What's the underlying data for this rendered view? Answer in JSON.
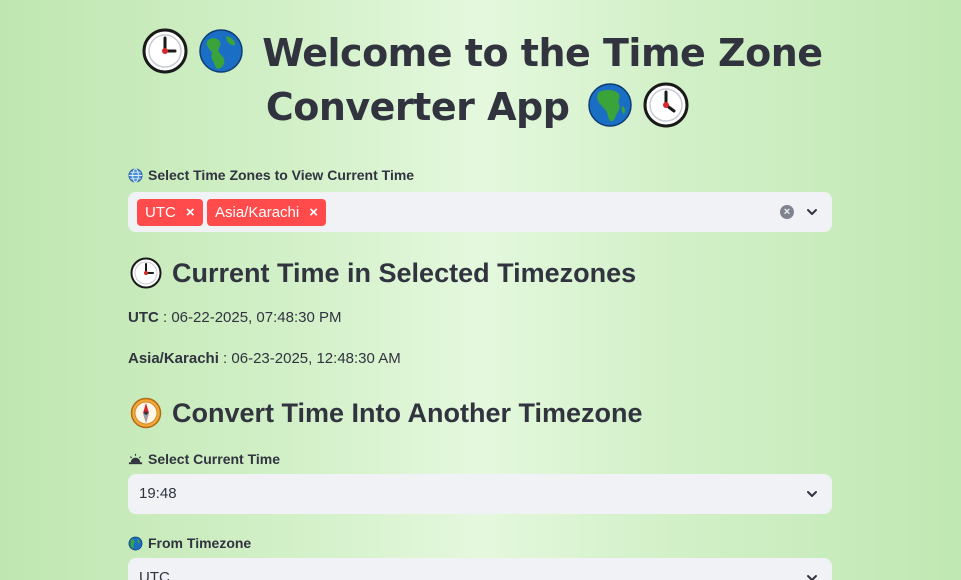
{
  "title": {
    "line1": "Welcome to the Time Zone",
    "line2": "Converter App",
    "icons": [
      "clock-icon",
      "globe-americas-icon",
      "globe-africa-icon",
      "clock-icon"
    ]
  },
  "view_section": {
    "label": "Select Time Zones to View Current Time",
    "label_icon": "globe-meridians-icon",
    "selected": [
      {
        "label": "UTC",
        "remove": "×"
      },
      {
        "label": "Asia/Karachi",
        "remove": "×"
      }
    ],
    "clear_glyph": "×"
  },
  "current_section": {
    "heading": "Current Time in Selected Timezones",
    "heading_icon": "clock-icon",
    "rows": [
      {
        "zone": "UTC",
        "sep": " : ",
        "time": "06-22-2025, 07:48:30 PM"
      },
      {
        "zone": "Asia/Karachi",
        "sep": " : ",
        "time": "06-23-2025, 12:48:30 AM"
      }
    ]
  },
  "convert_section": {
    "heading": "Convert Time Into Another Timezone",
    "heading_icon": "compass-icon",
    "current_time_label": "Select Current Time",
    "current_time_icon": "sunrise-icon",
    "current_time_value": "19:48",
    "from_label": "From Timezone",
    "from_icon": "globe-icon",
    "from_value": "UTC"
  },
  "colors": {
    "accent": "#ff4b4b",
    "input_bg": "#f0f2f6",
    "text": "#31333f"
  }
}
